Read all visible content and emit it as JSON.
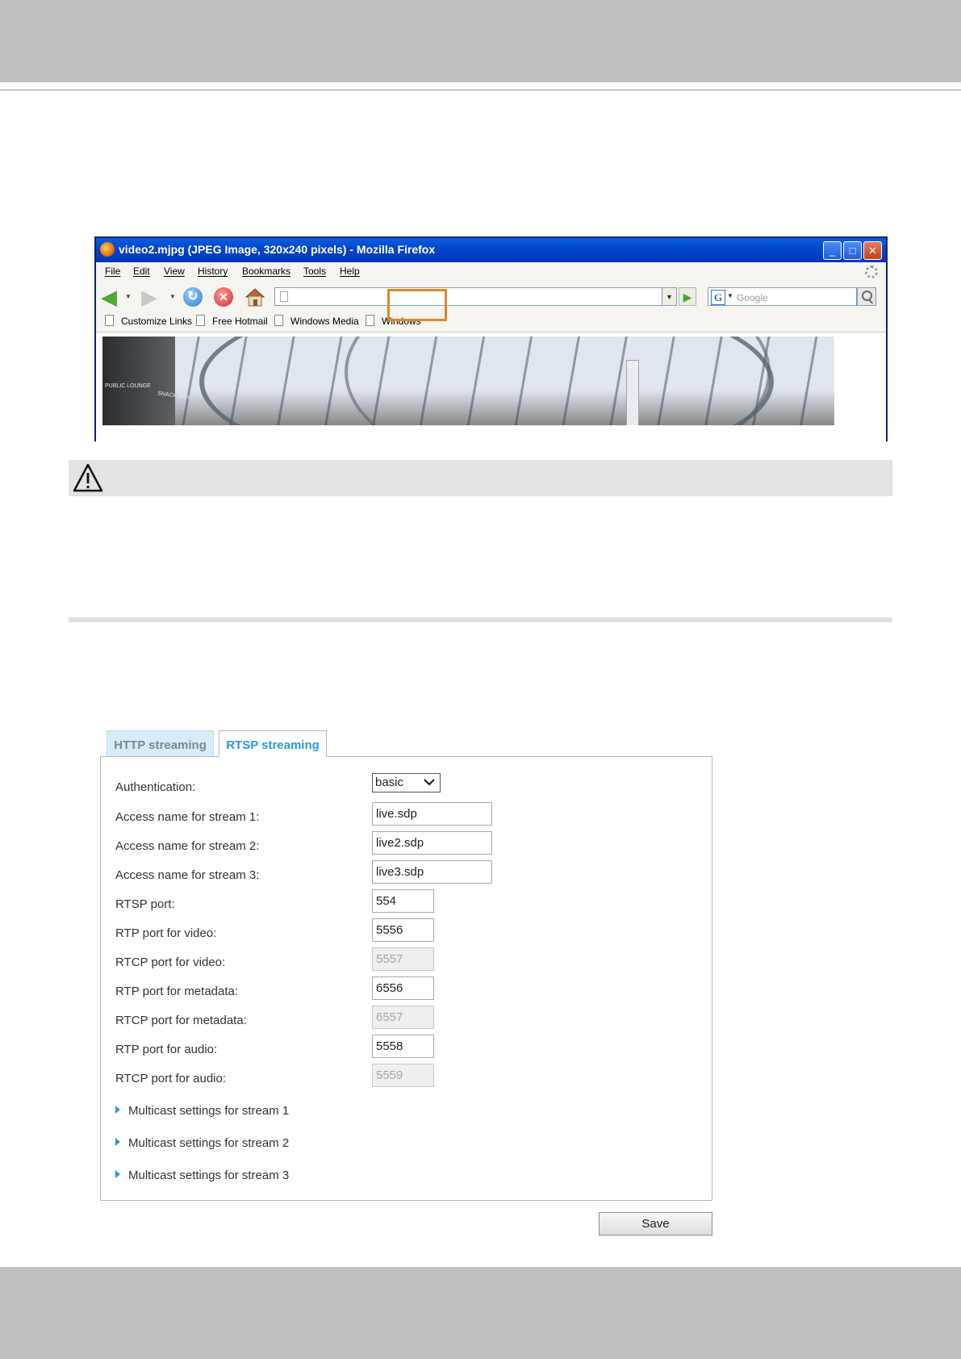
{
  "browser": {
    "title": "video2.mjpg (JPEG Image, 320x240 pixels) - Mozilla Firefox",
    "window_controls": [
      "minimize-icon",
      "maximize-icon",
      "close-icon"
    ],
    "menu": [
      "File",
      "Edit",
      "View",
      "History",
      "Bookmarks",
      "Tools",
      "Help"
    ],
    "url": "",
    "search_placeholder": "Google",
    "bookmarks": [
      "Customize Links",
      "Free Hotmail",
      "Windows Media",
      "Windows"
    ],
    "camera_signs": [
      "PUBLIC LOUNGE",
      "SNACK BAR"
    ],
    "highlight_color": "#d98a2b"
  },
  "notice": {
    "icon": "warning-icon"
  },
  "rtsp_panel": {
    "tabs": [
      {
        "label": "HTTP streaming",
        "active": false
      },
      {
        "label": "RTSP streaming",
        "active": true
      }
    ],
    "accent_color": "#2a9ad6",
    "authentication": {
      "label": "Authentication:",
      "value": "basic"
    },
    "fields": [
      {
        "label": "Access name for stream 1:",
        "value": "live.sdp",
        "disabled": false
      },
      {
        "label": "Access name for stream 2:",
        "value": "live2.sdp",
        "disabled": false
      },
      {
        "label": "Access name for stream 3:",
        "value": "live3.sdp",
        "disabled": false
      },
      {
        "label": "RTSP port:",
        "value": "554",
        "disabled": false
      },
      {
        "label": "RTP port for video:",
        "value": "5556",
        "disabled": false
      },
      {
        "label": "RTCP port for video:",
        "value": "5557",
        "disabled": true
      },
      {
        "label": "RTP port for metadata:",
        "value": "6556",
        "disabled": false
      },
      {
        "label": "RTCP port for metadata:",
        "value": "6557",
        "disabled": true
      },
      {
        "label": "RTP port for audio:",
        "value": "5558",
        "disabled": false
      },
      {
        "label": "RTCP port for audio:",
        "value": "5559",
        "disabled": true
      }
    ],
    "multicast": [
      "Multicast settings for stream 1",
      "Multicast settings for stream 2",
      "Multicast settings for stream 3"
    ],
    "save_label": "Save"
  }
}
